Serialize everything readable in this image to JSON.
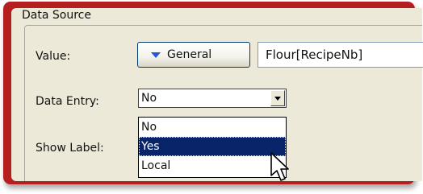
{
  "group": {
    "title": "Data Source"
  },
  "value_row": {
    "label": "Value:",
    "button_label": "General",
    "field_value": "Flour[RecipeNb]"
  },
  "data_entry": {
    "label": "Data Entry:",
    "selected": "No",
    "options": [
      "No",
      "Yes",
      "Local"
    ],
    "highlighted": "Yes"
  },
  "show_label": {
    "label": "Show Label:"
  },
  "colors": {
    "frame": "#b51f1f",
    "panel": "#ece9d8",
    "selection": "#0a246a",
    "button_arrow": "#2458d8"
  },
  "icons": {
    "button_arrow": "triangle-down-icon",
    "combo_arrow": "chevron-down-icon",
    "cursor": "mouse-pointer-icon"
  }
}
